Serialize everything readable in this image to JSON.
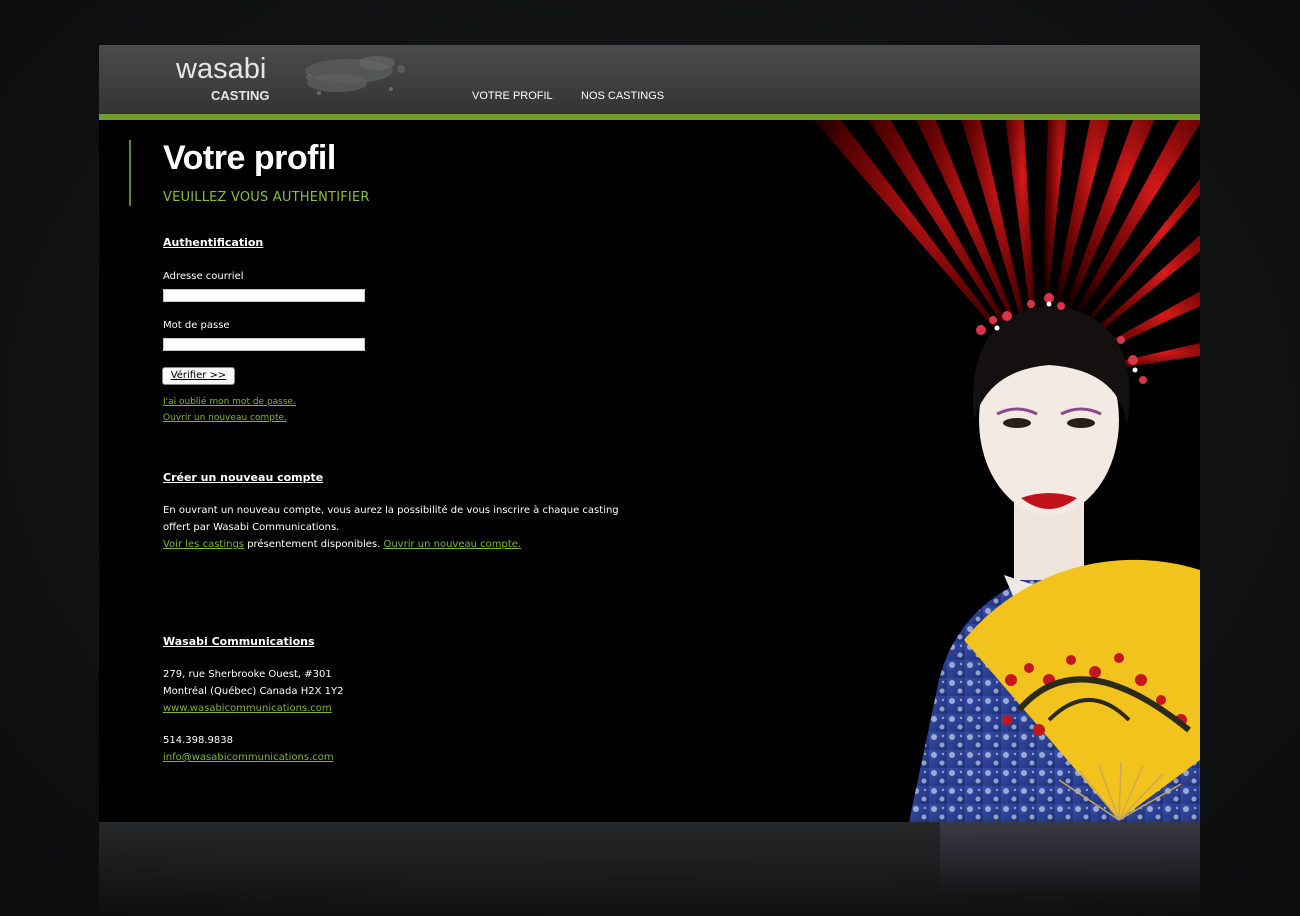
{
  "header": {
    "logo_word": "wasabi",
    "logo_sub": "CASTING",
    "nav": [
      "VOTRE PROFIL",
      "NOS CASTINGS"
    ]
  },
  "main": {
    "title": "Votre profil",
    "subtitle": "VEUILLEZ VOUS AUTHENTIFIER",
    "login": {
      "heading": "Authentification",
      "email_label": "Adresse courriel",
      "email_value": "",
      "password_label": "Mot de passe",
      "password_value": "",
      "submit_label": "Vérifier >>",
      "forgot_link": "J'ai oublié mon mot de passe.",
      "new_account_link": "Ouvrir un nouveau compte."
    },
    "create": {
      "heading": "Créer un nouveau compte",
      "text_line1": "En ouvrant un nouveau compte, vous aurez la possibilité de vous inscrire à chaque casting",
      "text_line2": "offert par Wasabi Communications.",
      "castings_link": "Voir les castings",
      "available_text": " présentement disponibles. ",
      "open_link": "Ouvrir un nouveau compte."
    },
    "contact": {
      "heading": "Wasabi Communications",
      "address1": "279, rue Sherbrooke Ouest, #301",
      "address2": "Montréal (Québec) Canada H2X 1Y2",
      "website": "www.wasabicommunications.com",
      "phone": "514.398.9838",
      "email": "info@wasabicommunications.com"
    }
  },
  "colors": {
    "accent_green": "#6f9e2a",
    "link_green": "#7db532",
    "background": "#000000"
  }
}
